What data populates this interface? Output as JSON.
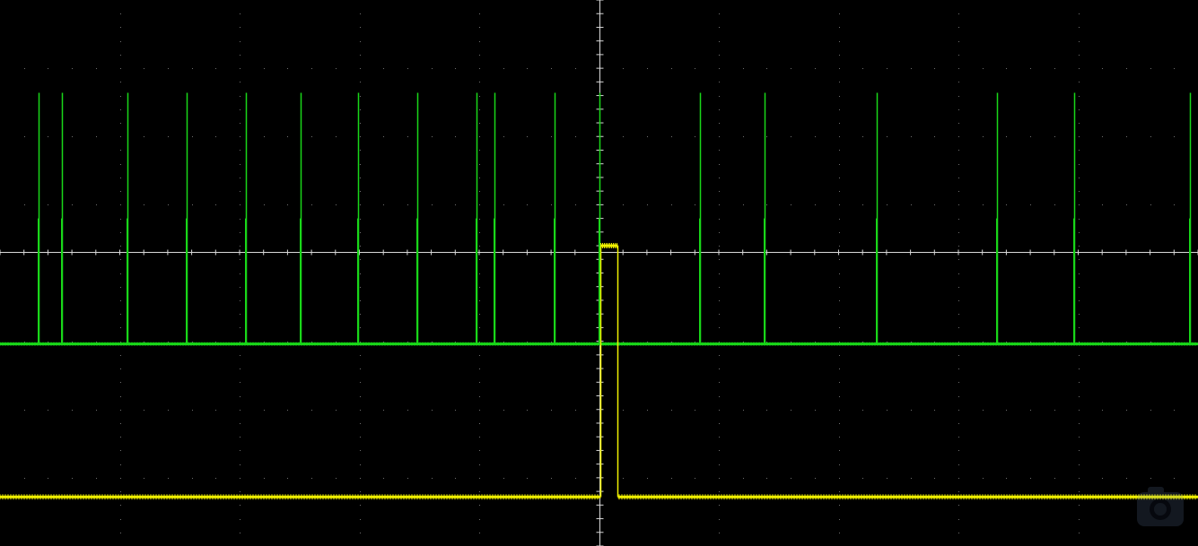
{
  "screen": {
    "background_color": "#000000",
    "grid_color": "#6f6f6f",
    "axis_color": "#d9d9d9"
  },
  "chart_data": {
    "type": "line",
    "grid": true,
    "series": [
      {
        "color": "#19d719",
        "baseline_level": 0.37,
        "pulse_level": 0.83,
        "pulses_t": [
          0.032,
          0.052,
          0.106,
          0.156,
          0.205,
          0.251,
          0.299,
          0.348,
          0.398,
          0.413,
          0.463,
          0.5,
          0.584,
          0.638,
          0.732,
          0.832,
          0.897,
          0.993
        ]
      },
      {
        "color": "#f0f000",
        "baseline_level": 0.09,
        "high_level": 0.55,
        "pulse_start_t": 0.501,
        "pulse_end_t": 0.515
      }
    ]
  },
  "watermark": {
    "icon": "camera-logo-icon"
  }
}
